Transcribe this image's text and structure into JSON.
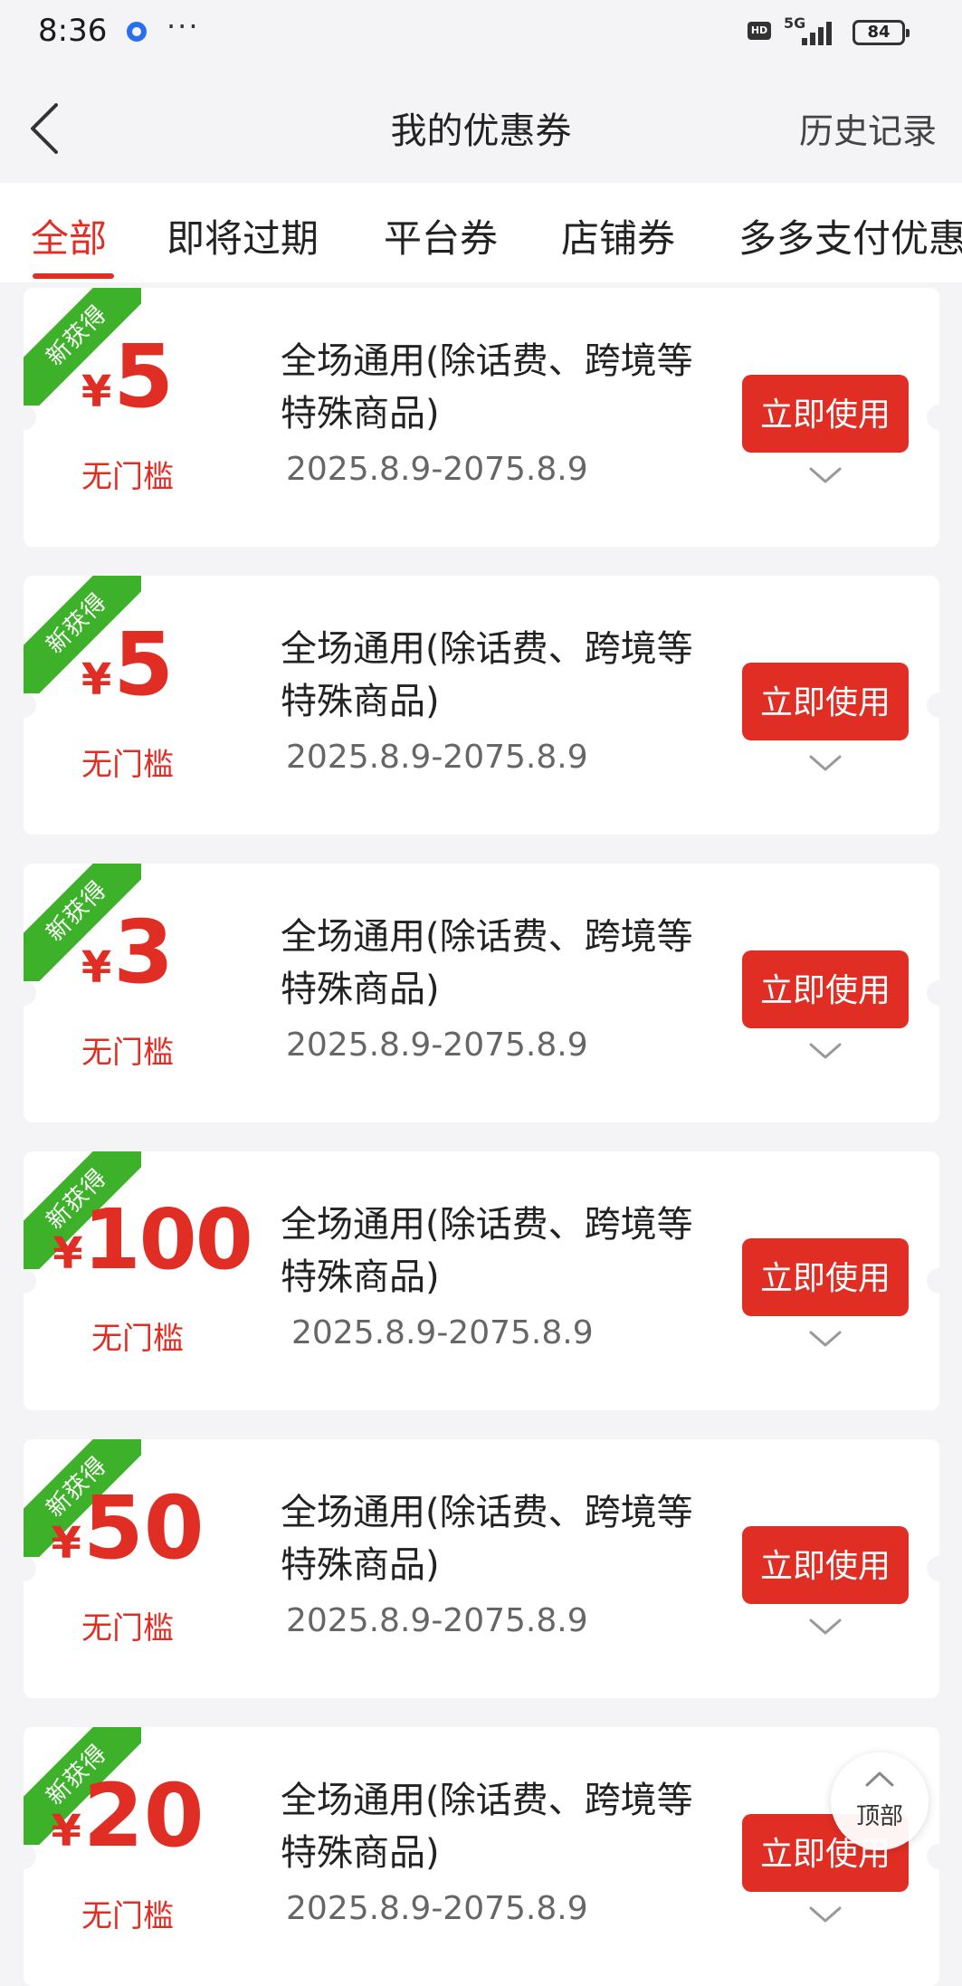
{
  "status_bar": {
    "time": "8:36",
    "more": "···",
    "hd": "HD",
    "network": "5G",
    "battery": "84"
  },
  "header": {
    "title": "我的优惠券",
    "history": "历史记录"
  },
  "tabs": [
    {
      "label": "全部",
      "active": true
    },
    {
      "label": "即将过期",
      "active": false
    },
    {
      "label": "平台券",
      "active": false
    },
    {
      "label": "店铺券",
      "active": false
    },
    {
      "label": "多多支付优惠",
      "active": false
    }
  ],
  "coupons": [
    {
      "badge": "新获得",
      "currency": "¥",
      "amount": "5",
      "threshold": "无门槛",
      "desc": "全场通用(除话费、跨境等特殊商品)",
      "date": "2025.8.9-2075.8.9",
      "button": "立即使用"
    },
    {
      "badge": "新获得",
      "currency": "¥",
      "amount": "5",
      "threshold": "无门槛",
      "desc": "全场通用(除话费、跨境等特殊商品)",
      "date": "2025.8.9-2075.8.9",
      "button": "立即使用"
    },
    {
      "badge": "新获得",
      "currency": "¥",
      "amount": "3",
      "threshold": "无门槛",
      "desc": "全场通用(除话费、跨境等特殊商品)",
      "date": "2025.8.9-2075.8.9",
      "button": "立即使用"
    },
    {
      "badge": "新获得",
      "currency": "¥",
      "amount": "100",
      "threshold": "无门槛",
      "desc": "全场通用(除话费、跨境等特殊商品)",
      "date": "2025.8.9-2075.8.9",
      "button": "立即使用"
    },
    {
      "badge": "新获得",
      "currency": "¥",
      "amount": "50",
      "threshold": "无门槛",
      "desc": "全场通用(除话费、跨境等特殊商品)",
      "date": "2025.8.9-2075.8.9",
      "button": "立即使用"
    },
    {
      "badge": "新获得",
      "currency": "¥",
      "amount": "20",
      "threshold": "无门槛",
      "desc": "全场通用(除话费、跨境等特殊商品)",
      "date": "2025.8.9-2075.8.9",
      "button": "立即使用"
    }
  ],
  "back_to_top": "顶部",
  "colors": {
    "accent": "#e02e24",
    "badge": "#3db12a",
    "background": "#f4f3f5"
  }
}
